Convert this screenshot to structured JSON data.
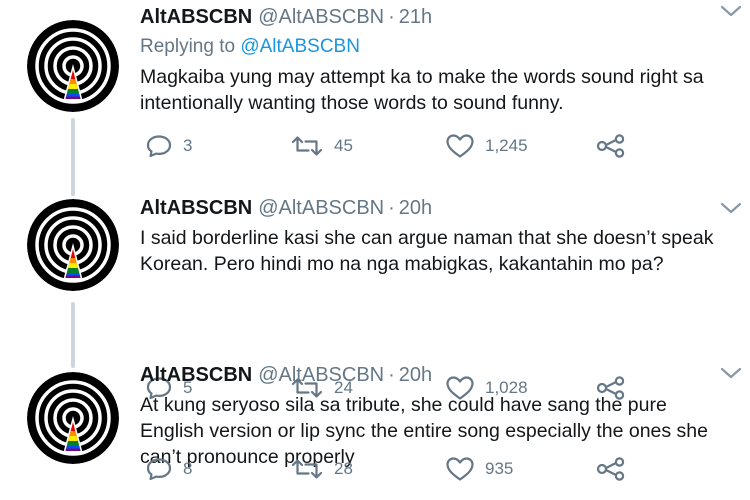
{
  "colors": {
    "name_text": "#14171a",
    "muted_text": "#657786",
    "link": "#1b95e0",
    "thread_line": "#ccd6dd"
  },
  "icons": {
    "avatar": "concentric-rings-rainbow-triangle-logo",
    "reply": "speech-bubble-icon",
    "retweet": "retweet-arrows-icon",
    "like": "heart-icon",
    "share": "share-nodes-icon",
    "menu": "chevron-down-icon"
  },
  "tweets": [
    {
      "name": "AltABSCBN",
      "handle": "@AltABSCBN",
      "separator": "·",
      "time": "21h",
      "replying_label": "Replying to",
      "replying_to": "@AltABSCBN",
      "text": "Magkaiba yung may attempt ka to make the words sound right sa intentionally wanting those words to sound funny.",
      "replies": "3",
      "retweets": "45",
      "likes": "1,245"
    },
    {
      "name": "AltABSCBN",
      "handle": "@AltABSCBN",
      "separator": "·",
      "time": "20h",
      "text": "I said borderline kasi she can argue naman that she doesn’t speak Korean. Pero hindi mo na nga mabigkas, kakantahin mo pa?",
      "replies": "5",
      "retweets": "24",
      "likes": "1,028"
    },
    {
      "name": "AltABSCBN",
      "handle": "@AltABSCBN",
      "separator": "·",
      "time": "20h",
      "text": "At kung seryoso sila sa tribute, she could have sang the pure English version or lip sync the entire song especially the ones she can’t pronounce properly",
      "replies": "8",
      "retweets": "28",
      "likes": "935"
    }
  ]
}
